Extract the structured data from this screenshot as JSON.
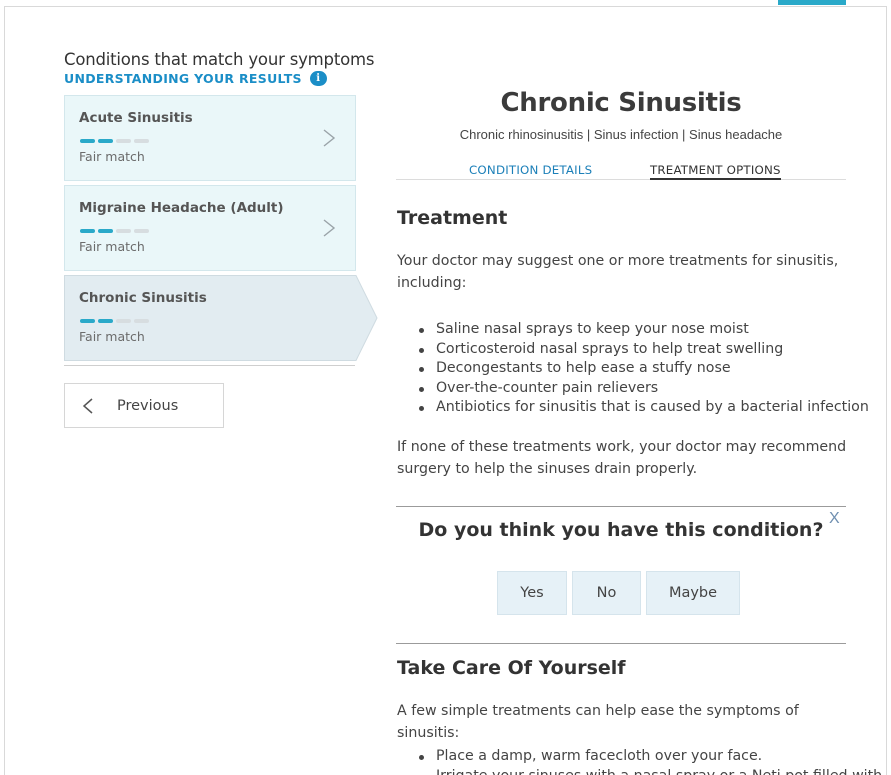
{
  "sidebar": {
    "title": "Conditions that match your symptoms",
    "understanding_link": "UNDERSTANDING YOUR RESULTS",
    "info_icon": "i",
    "conditions": [
      {
        "name": "Acute Sinusitis",
        "match": "Fair match",
        "match_level": 2,
        "match_max": 4
      },
      {
        "name": "Migraine Headache (Adult)",
        "match": "Fair match",
        "match_level": 2,
        "match_max": 4
      },
      {
        "name": "Chronic Sinusitis",
        "match": "Fair match",
        "match_level": 2,
        "match_max": 4,
        "selected": true
      }
    ],
    "previous_label": "Previous"
  },
  "condition": {
    "title": "Chronic Sinusitis",
    "aliases": "Chronic rhinosinusitis | Sinus infection | Sinus headache",
    "tabs": {
      "details": "CONDITION DETAILS",
      "treatment": "TREATMENT OPTIONS",
      "active": "treatment"
    }
  },
  "treatment": {
    "heading": "Treatment",
    "intro": "Your doctor may suggest one or more treatments for sinusitis, including:",
    "items": [
      "Saline nasal sprays to keep your nose moist",
      "Corticosteroid nasal sprays to help treat swelling",
      "Decongestants to help ease a stuffy nose",
      "Over-the-counter pain relievers",
      "Antibiotics for sinusitis that is caused by a bacterial infection"
    ],
    "outro": "If none of these treatments work, your doctor may recommend surgery to help the sinuses drain properly."
  },
  "survey": {
    "question": "Do you think you have this condition?",
    "close_label": "X",
    "answers": {
      "yes": "Yes",
      "no": "No",
      "maybe": "Maybe"
    }
  },
  "self_care": {
    "heading": "Take Care Of Yourself",
    "intro": "A few simple treatments can help ease the symptoms of sinusitis:",
    "items": [
      "Place a damp, warm facecloth over your face.",
      "Irrigate your sinuses with a nasal spray or a Neti pot filled with"
    ]
  },
  "colors": {
    "accent": "#2aa9c9",
    "link": "#1b8ec7",
    "card_bg": "#eaf7f9",
    "selected_bg": "#e2ecf1",
    "answer_bg": "#e6f1f7"
  }
}
